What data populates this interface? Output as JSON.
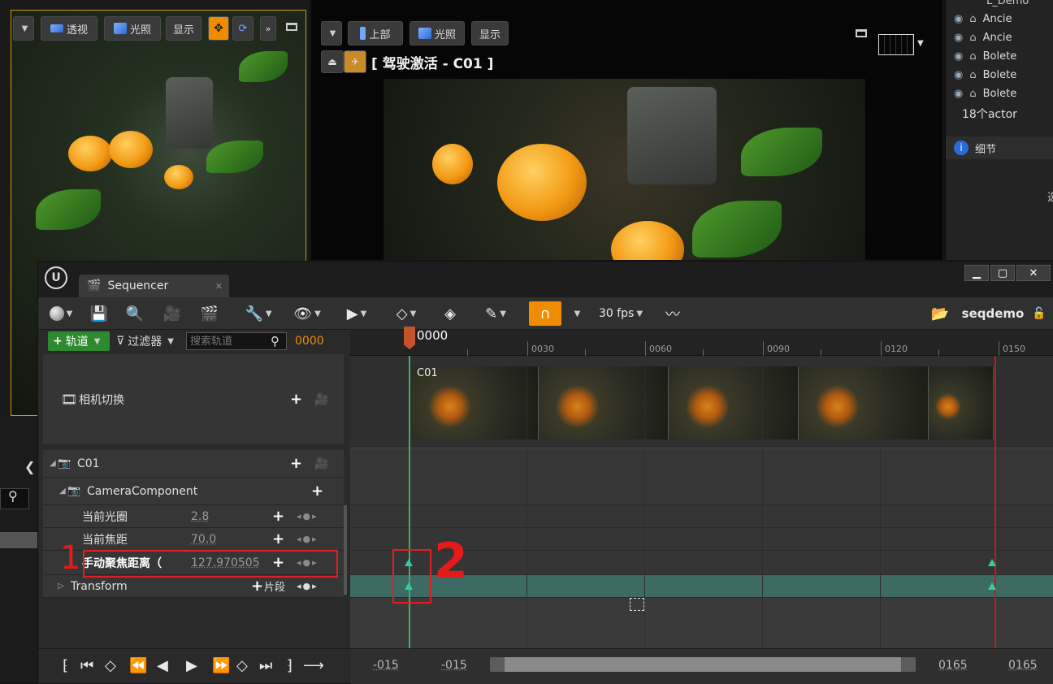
{
  "viewport_left": {
    "buttons": [
      {
        "label": "透视"
      },
      {
        "label": "光照"
      },
      {
        "label": "显示"
      }
    ]
  },
  "viewport_right": {
    "buttons": [
      {
        "label": "上部"
      },
      {
        "label": "光照"
      },
      {
        "label": "显示"
      }
    ],
    "pilot_label": "[ 驾驶激活 - C01 ]"
  },
  "outliner": {
    "root_label": "L_Demo",
    "items": [
      "Ancie",
      "Ancie",
      "Bolete",
      "Bolete",
      "Bolete"
    ],
    "count_label": "18个actor",
    "details_label": "细节",
    "edge_char": "选"
  },
  "sequencer": {
    "tab_label": "Sequencer",
    "fps_label": "30 fps",
    "sequence_name": "seqdemo",
    "track_button": "轨道",
    "filter_button": "过滤器",
    "search_placeholder": "搜索轨道",
    "current_frame": "0000",
    "playhead_frame": "0000",
    "tracks": {
      "camera_cut": "相机切换",
      "c01": "C01",
      "camera_component": "CameraComponent",
      "aperture_label": "当前光圈",
      "aperture_value": "2.8",
      "focal_label": "当前焦距",
      "focal_value": "70.0",
      "focus_label": "手动聚焦距离（",
      "focus_value": "127.970505",
      "transform_label": "Transform",
      "section_label": "片段"
    },
    "ruler_ticks": [
      "0030",
      "0060",
      "0090",
      "0120",
      "0150"
    ],
    "clip_label": "C01",
    "range_start_a": "-015",
    "range_start_b": "-015",
    "range_end_a": "0165",
    "range_end_b": "0165"
  },
  "annotations": {
    "one": "1",
    "two": "2"
  },
  "colors": {
    "accent_orange": "#f08c00",
    "key_green": "#2ad1a0",
    "playhead": "#c3542a",
    "annotation_red": "#e02020"
  }
}
